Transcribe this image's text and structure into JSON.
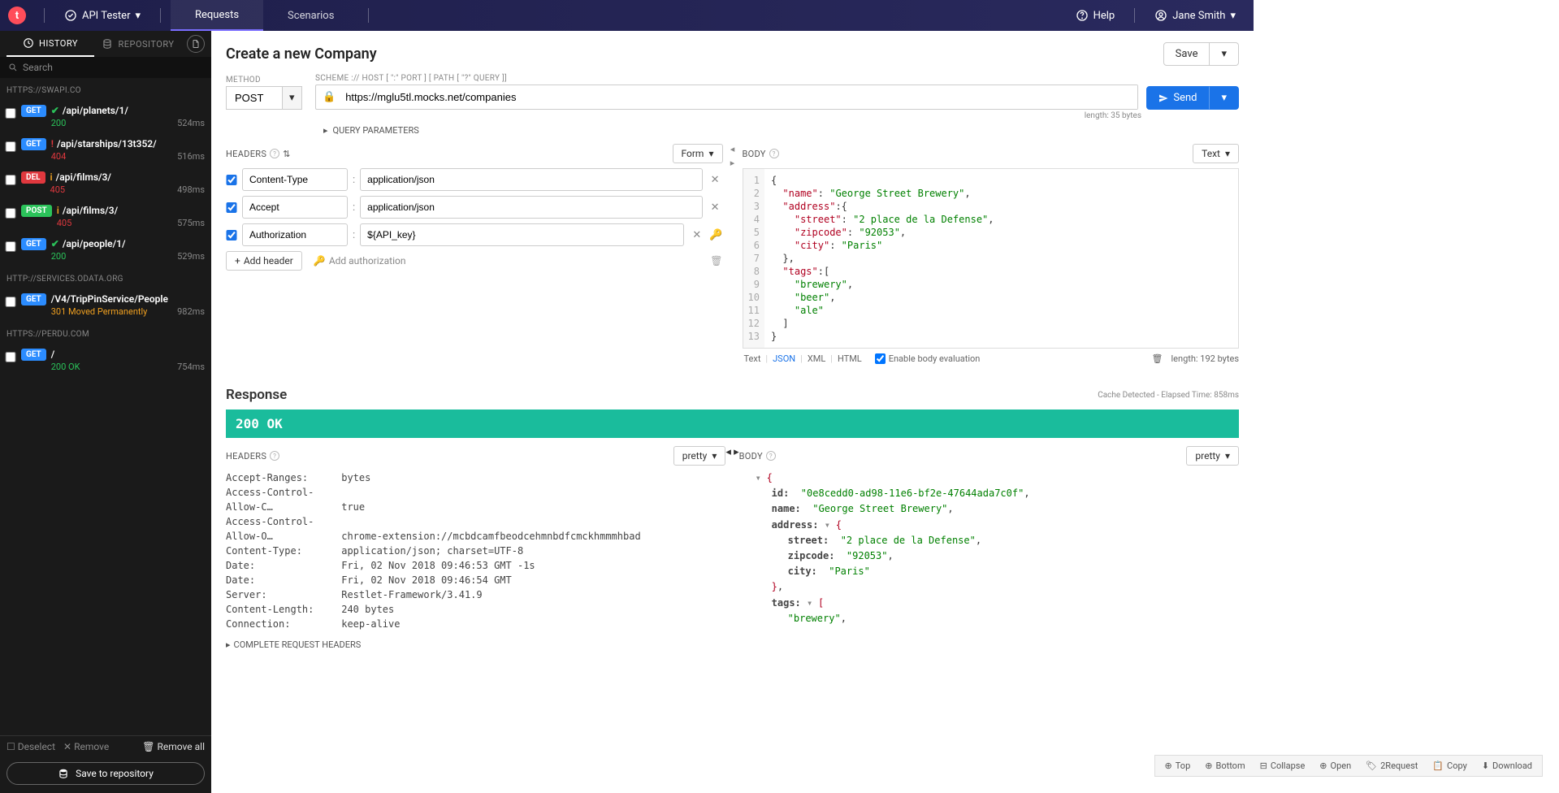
{
  "topbar": {
    "app_name": "API Tester",
    "tab_requests": "Requests",
    "tab_scenarios": "Scenarios",
    "help": "Help",
    "user": "Jane Smith"
  },
  "sidebar": {
    "tab_history": "HISTORY",
    "tab_repository": "REPOSITORY",
    "search_placeholder": "Search",
    "groups": [
      {
        "title": "HTTPS://SWAPI.CO",
        "items": [
          {
            "method": "GET",
            "methodClass": "get",
            "icon": "check",
            "path": "/api/planets/1/",
            "status": "200",
            "statusClass": "ok",
            "time": "524ms"
          },
          {
            "method": "GET",
            "methodClass": "get",
            "icon": "warn",
            "path": "/api/starships/13t352/",
            "status": "404",
            "statusClass": "err",
            "time": "516ms"
          },
          {
            "method": "DEL",
            "methodClass": "del",
            "icon": "info",
            "path": "/api/films/3/",
            "status": "405",
            "statusClass": "err",
            "time": "498ms"
          },
          {
            "method": "POST",
            "methodClass": "post",
            "icon": "info",
            "path": "/api/films/3/",
            "status": "405",
            "statusClass": "err",
            "time": "575ms"
          },
          {
            "method": "GET",
            "methodClass": "get",
            "icon": "check",
            "path": "/api/people/1/",
            "status": "200",
            "statusClass": "ok",
            "time": "529ms"
          }
        ]
      },
      {
        "title": "HTTP://SERVICES.ODATA.ORG",
        "items": [
          {
            "method": "GET",
            "methodClass": "get",
            "icon": "",
            "path": "/V4/TripPinService/People",
            "status": "301 Moved Permanently",
            "statusClass": "warn",
            "time": "982ms"
          }
        ]
      },
      {
        "title": "HTTPS://PERDU.COM",
        "items": [
          {
            "method": "GET",
            "methodClass": "get",
            "icon": "",
            "path": "/",
            "status": "200 OK",
            "statusClass": "ok",
            "time": "754ms"
          }
        ]
      }
    ],
    "deselect": "Deselect",
    "remove": "Remove",
    "remove_all": "Remove all",
    "save_repo": "Save to repository"
  },
  "request": {
    "title": "Create a new Company",
    "save": "Save",
    "send": "Send",
    "method_label": "METHOD",
    "method": "POST",
    "url_label": "SCHEME :// HOST [ \":\" PORT ] [ PATH [ \"?\" QUERY ]]",
    "url": "https://mglu5tl.mocks.net/companies",
    "url_length": "length: 35 bytes",
    "query_params": "QUERY PARAMETERS",
    "headers": {
      "label": "HEADERS",
      "mode": "Form",
      "rows": [
        {
          "k": "Content-Type",
          "v": "application/json"
        },
        {
          "k": "Accept",
          "v": "application/json"
        },
        {
          "k": "Authorization",
          "v": "${API_key}"
        }
      ],
      "add": "Add header",
      "add_auth": "Add authorization"
    },
    "body": {
      "label": "BODY",
      "mode": "Text",
      "lines": 13,
      "length": "length: 192 bytes",
      "enable_eval": "Enable body evaluation",
      "modes": {
        "text": "Text",
        "json": "JSON",
        "xml": "XML",
        "html": "HTML"
      }
    }
  },
  "response": {
    "title": "Response",
    "meta": "Cache Detected - Elapsed Time: 858ms",
    "status": "200 OK",
    "headers_label": "HEADERS",
    "headers_mode": "pretty",
    "body_label": "BODY",
    "body_mode": "pretty",
    "headers_list": [
      {
        "k": "Accept-Ranges:",
        "v": "bytes"
      },
      {
        "k": "Access-Control-Allow-C…",
        "v": "true"
      },
      {
        "k": "Access-Control-Allow-O…",
        "v": "chrome-extension://mcbdcamfbeodcehmnbdfcmckhmmmhbad"
      },
      {
        "k": "Content-Type:",
        "v": "application/json; charset=UTF-8"
      },
      {
        "k": "Date:",
        "v": "Fri, 02 Nov 2018 09:46:53 GMT -1s"
      },
      {
        "k": "Date:",
        "v": "Fri, 02 Nov 2018 09:46:54 GMT"
      },
      {
        "k": "Server:",
        "v": "Restlet-Framework/3.41.9"
      },
      {
        "k": "Content-Length:",
        "v": "240 bytes"
      },
      {
        "k": "Connection:",
        "v": "keep-alive"
      }
    ],
    "complete_headers": "COMPLETE REQUEST HEADERS",
    "json": {
      "id": "\"0e8cedd0-ad98-11e6-bf2e-47644ada7c0f\"",
      "name": "\"George Street Brewery\"",
      "street": "\"2 place de la Defense\"",
      "zipcode": "\"92053\"",
      "city": "\"Paris\"",
      "tag0": "\"brewery\""
    },
    "toolbar": {
      "top": "Top",
      "bottom": "Bottom",
      "collapse": "Collapse",
      "open": "Open",
      "toreq": "2Request",
      "copy": "Copy",
      "download": "Download"
    }
  }
}
